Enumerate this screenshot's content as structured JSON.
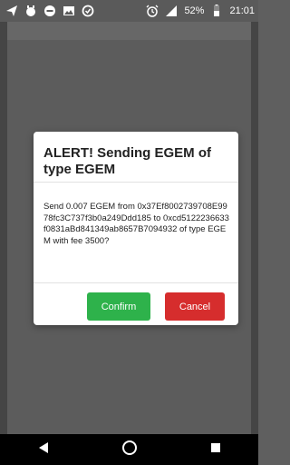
{
  "status_bar": {
    "icons_left": [
      "send-icon",
      "face-icon",
      "minus-circle-icon",
      "image-icon",
      "shield-icon"
    ],
    "icons_right": [
      "alarm-icon",
      "signal-icon",
      "battery-icon"
    ],
    "battery": "52%",
    "time": "21:01"
  },
  "dialog": {
    "title": "ALERT! Sending EGEM of type EGEM",
    "message": "Send 0.007 EGEM from 0x37Ef8002739708E9978fc3C737f3b0a249Ddd185 to 0xcd5122236633f0831aBd841349ab8657B7094932 of type EGEM with fee 3500?",
    "confirm_label": "Confirm",
    "cancel_label": "Cancel"
  },
  "colors": {
    "confirm": "#2eb24b",
    "cancel": "#d62d2d",
    "overlay": "#5f5f5f"
  },
  "nav": {
    "icons": [
      "back-icon",
      "home-icon",
      "recents-icon"
    ]
  }
}
